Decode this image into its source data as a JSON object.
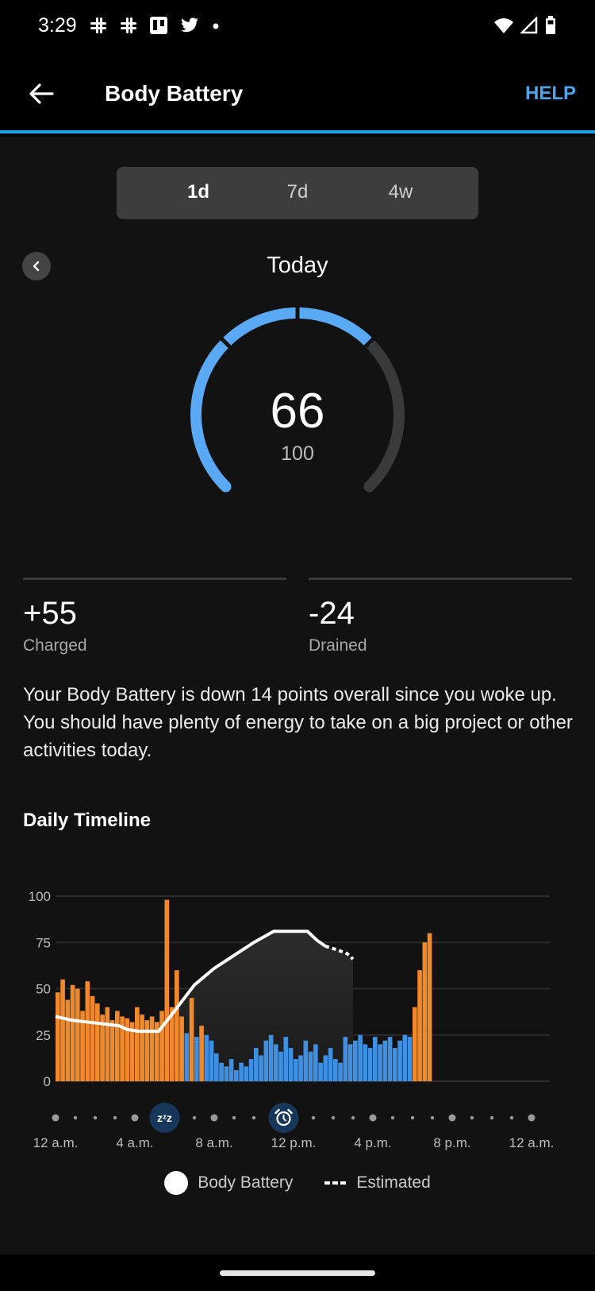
{
  "status_bar": {
    "time": "3:29",
    "left_icons": [
      "slack-icon",
      "slack-icon",
      "trello-icon",
      "twitter-icon",
      "more-dot-icon"
    ],
    "right_icons": [
      "wifi-icon",
      "cell-signal-icon",
      "battery-icon"
    ]
  },
  "app_bar": {
    "title": "Body Battery",
    "help_label": "HELP",
    "accent_color": "#1fa3e6"
  },
  "range_tabs": [
    {
      "label": "1d",
      "active": true
    },
    {
      "label": "7d",
      "active": false
    },
    {
      "label": "4w",
      "active": false
    }
  ],
  "period": {
    "label": "Today"
  },
  "gauge": {
    "value": "66",
    "max": "100",
    "fill_fraction": 0.66,
    "fill_color": "#5aa9f5",
    "track_color": "#3a3a3a"
  },
  "stats": [
    {
      "value": "+55",
      "label": "Charged"
    },
    {
      "value": "-24",
      "label": "Drained"
    }
  ],
  "summary_text": "Your Body Battery is down 14 points overall since you woke up. You should have plenty of energy to take on a big project or other activities today.",
  "timeline": {
    "title": "Daily Timeline"
  },
  "chart_data": {
    "type": "bar",
    "title": "Daily Timeline",
    "xlabel": "",
    "ylabel": "",
    "x_range_hours": [
      0,
      24
    ],
    "ylim": [
      0,
      100
    ],
    "y_ticks": [
      "0",
      "25",
      "50",
      "75",
      "100"
    ],
    "x_tick_labels": [
      "12 a.m.",
      "4 a.m.",
      "8 a.m.",
      "12 p.m.",
      "4 p.m.",
      "8 p.m.",
      "12 a.m."
    ],
    "grid": true,
    "stress_colors": {
      "high": "#f0892c",
      "rest": "#3f8fe3"
    },
    "stress_series": {
      "name": "Stress",
      "interval_minutes": 15,
      "start_hour": 0,
      "values": [
        48,
        55,
        44,
        52,
        50,
        38,
        54,
        46,
        42,
        36,
        40,
        33,
        38,
        35,
        34,
        32,
        40,
        36,
        33,
        35,
        32,
        38,
        98,
        40,
        60,
        35,
        26,
        45,
        24,
        30,
        25,
        22,
        15,
        10,
        8,
        12,
        6,
        10,
        8,
        12,
        18,
        14,
        22,
        25,
        20,
        16,
        24,
        18,
        12,
        14,
        22,
        16,
        20,
        10,
        14,
        18,
        12,
        10,
        24,
        20,
        22,
        25,
        20,
        18,
        24,
        20,
        22,
        24,
        18,
        22,
        25,
        24,
        40,
        60,
        75,
        80
      ],
      "types": [
        "high",
        "high",
        "high",
        "high",
        "high",
        "high",
        "high",
        "high",
        "high",
        "high",
        "high",
        "high",
        "high",
        "high",
        "high",
        "high",
        "high",
        "high",
        "high",
        "high",
        "high",
        "high",
        "high",
        "high",
        "high",
        "high",
        "rest",
        "high",
        "rest",
        "high",
        "rest",
        "rest",
        "rest",
        "rest",
        "rest",
        "rest",
        "rest",
        "rest",
        "rest",
        "rest",
        "rest",
        "rest",
        "rest",
        "rest",
        "rest",
        "rest",
        "rest",
        "rest",
        "rest",
        "rest",
        "rest",
        "rest",
        "rest",
        "rest",
        "rest",
        "rest",
        "rest",
        "rest",
        "rest",
        "rest",
        "rest",
        "rest",
        "rest",
        "rest",
        "rest",
        "rest",
        "rest",
        "rest",
        "rest",
        "rest",
        "rest",
        "rest",
        "high",
        "high",
        "high",
        "high"
      ]
    },
    "series": [
      {
        "name": "Body Battery",
        "style": "solid",
        "points": [
          [
            0,
            35
          ],
          [
            0.8,
            33
          ],
          [
            1.6,
            32
          ],
          [
            2.4,
            31
          ],
          [
            3.2,
            30
          ],
          [
            3.6,
            28
          ],
          [
            4.2,
            27
          ],
          [
            5.2,
            27
          ],
          [
            6.0,
            38
          ],
          [
            7.0,
            52
          ],
          [
            8.0,
            61
          ],
          [
            9.0,
            68
          ],
          [
            10.0,
            75
          ],
          [
            11.0,
            81
          ],
          [
            12.7,
            81
          ],
          [
            13.2,
            76
          ],
          [
            13.6,
            73
          ]
        ]
      },
      {
        "name": "Estimated",
        "style": "dashed",
        "points": [
          [
            13.6,
            73
          ],
          [
            14.2,
            71
          ],
          [
            14.7,
            69
          ],
          [
            15.0,
            66
          ]
        ]
      }
    ],
    "markers": [
      {
        "name": "sleep",
        "hour": 5.5,
        "icon": "sleep-zzz-icon"
      },
      {
        "name": "wake",
        "hour": 11.5,
        "icon": "alarm-clock-icon"
      }
    ],
    "legend": [
      "Body Battery",
      "Estimated"
    ],
    "legend_position": "bottom"
  }
}
